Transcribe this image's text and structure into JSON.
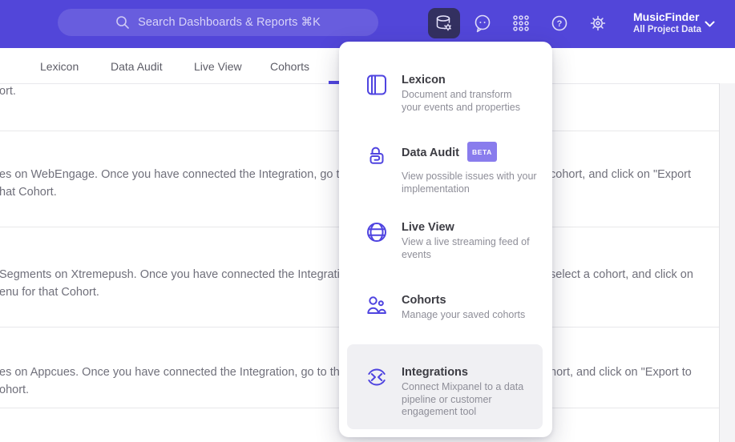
{
  "colors": {
    "header_bg": "#5246d9",
    "accent": "#4f44e0",
    "active_icon_bg": "#333060",
    "badge_bg": "#897ced",
    "highlight_bg": "#f0f0f3"
  },
  "header": {
    "search_placeholder": "Search Dashboards & Reports ⌘K",
    "project_name": "MusicFinder",
    "project_subtitle": "All Project Data",
    "icons": [
      "search-icon",
      "data-management-icon",
      "feedback-icon",
      "apps-grid-icon",
      "help-icon",
      "settings-icon",
      "chevron-down-icon"
    ]
  },
  "tabs": [
    {
      "label": "Lexicon"
    },
    {
      "label": "Data Audit"
    },
    {
      "label": "Live View"
    },
    {
      "label": "Cohorts"
    }
  ],
  "menu": {
    "items": [
      {
        "label": "Lexicon",
        "icon": "book-icon",
        "description": "Document and transform\nyour events and properties"
      },
      {
        "label": "Data Audit",
        "icon": "lock-spiral-icon",
        "badge": "BETA",
        "description": "View possible issues with your\nimplementation"
      },
      {
        "label": "Live View",
        "icon": "globe-icon",
        "description": "View a live streaming feed of\nevents"
      },
      {
        "label": "Cohorts",
        "icon": "people-icon",
        "description": "Manage your saved cohorts"
      },
      {
        "label": "Integrations",
        "icon": "sync-arrows-icon",
        "highlighted": true,
        "description": "Connect Mixpanel to a data\npipeline or customer\nengagement tool"
      }
    ]
  },
  "page_fragments": [
    {
      "text": "ort."
    },
    {
      "text": "es on WebEngage. Once you have connected the Integration, go to the"
    },
    {
      "text": "cohort, and click on \"Export"
    },
    {
      "text": "hat Cohort."
    },
    {
      "text": "Segments on Xtremepush. Once you have connected the Integration,"
    },
    {
      "text": "select a cohort, and click on"
    },
    {
      "text": "enu for that Cohort."
    },
    {
      "text": "es on Appcues. Once you have connected the Integration, go to the M"
    },
    {
      "text": "hort, and click on \"Export to"
    },
    {
      "text": "ohort."
    }
  ]
}
